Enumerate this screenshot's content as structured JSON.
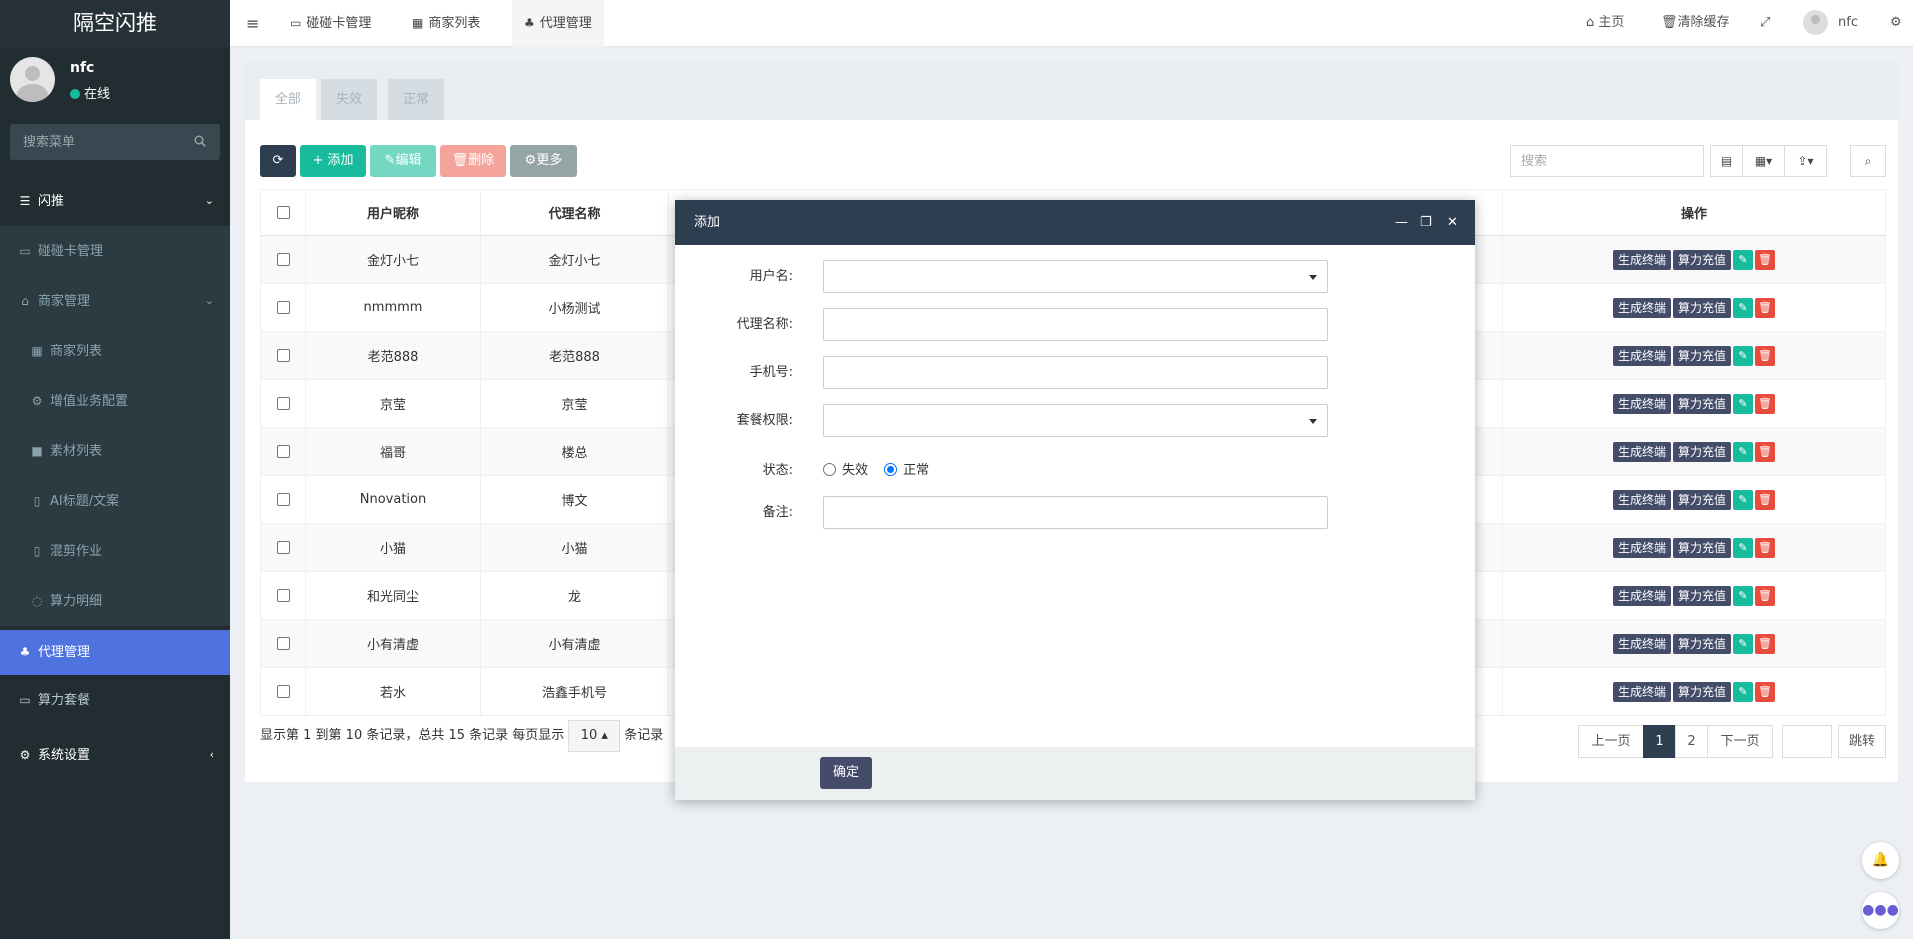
{
  "brand": "隔空闪推",
  "user": {
    "name": "nfc",
    "status": "在线"
  },
  "sidebar": {
    "search_placeholder": "搜索菜单",
    "items": [
      {
        "label": "闪推",
        "icon": "list-icon"
      },
      {
        "label": "碰碰卡管理",
        "icon": "card-icon"
      },
      {
        "label": "商家管理",
        "icon": "bank-icon"
      },
      {
        "label": "商家列表",
        "icon": "grid-icon"
      },
      {
        "label": "增值业务配置",
        "icon": "cogs-icon"
      },
      {
        "label": "素材列表",
        "icon": "video-icon"
      },
      {
        "label": "AI标题/文案",
        "icon": "file-icon"
      },
      {
        "label": "混剪作业",
        "icon": "file-icon"
      },
      {
        "label": "算力明细",
        "icon": "circle-icon"
      },
      {
        "label": "代理管理",
        "icon": "sitemap-icon"
      },
      {
        "label": "算力套餐",
        "icon": "card-icon"
      },
      {
        "label": "系统设置",
        "icon": "cogs-icon"
      }
    ]
  },
  "navbar": {
    "tabs": [
      {
        "label": "碰碰卡管理"
      },
      {
        "label": "商家列表"
      },
      {
        "label": "代理管理"
      }
    ],
    "home": "主页",
    "clear_cache": "清除缓存",
    "username": "nfc"
  },
  "panel": {
    "tabs": [
      "全部",
      "失效",
      "正常"
    ],
    "toolbar": {
      "add": "添加",
      "edit": "编辑",
      "delete": "删除",
      "more": "更多"
    },
    "search_placeholder": "搜索"
  },
  "table": {
    "headers": {
      "nickname": "用户昵称",
      "agent_name": "代理名称",
      "action": "操作"
    },
    "rows": [
      {
        "nickname": "金灯小七",
        "agent_name": "金灯小七"
      },
      {
        "nickname": "nmmmm",
        "agent_name": "小杨测试"
      },
      {
        "nickname": "老范888",
        "agent_name": "老范888"
      },
      {
        "nickname": "京莹",
        "agent_name": "京莹"
      },
      {
        "nickname": "福哥",
        "agent_name": "楼总"
      },
      {
        "nickname": "Nnovation",
        "agent_name": "博文"
      },
      {
        "nickname": "小猫",
        "agent_name": "小猫"
      },
      {
        "nickname": "和光同尘",
        "agent_name": "龙"
      },
      {
        "nickname": "小有清虚",
        "agent_name": "小有清虚"
      },
      {
        "nickname": "若水",
        "agent_name": "浩鑫手机号"
      }
    ],
    "row_actions": {
      "gen_terminal": "生成终端",
      "recharge": "算力充值"
    }
  },
  "pagination": {
    "info_prefix": "显示第 1 到第 10 条记录，总共 15 条记录 每页显示",
    "page_size": "10",
    "info_suffix": "条记录",
    "prev": "上一页",
    "pages": [
      "1",
      "2"
    ],
    "current_page": "1",
    "next": "下一页",
    "jump": "跳转"
  },
  "modal": {
    "title": "添加",
    "fields": {
      "username": "用户名:",
      "agent_name": "代理名称:",
      "phone": "手机号:",
      "package": "套餐权限:",
      "status": "状态:",
      "remark": "备注:"
    },
    "status_options": [
      "失效",
      "正常"
    ],
    "status_selected": "正常",
    "confirm": "确定"
  }
}
